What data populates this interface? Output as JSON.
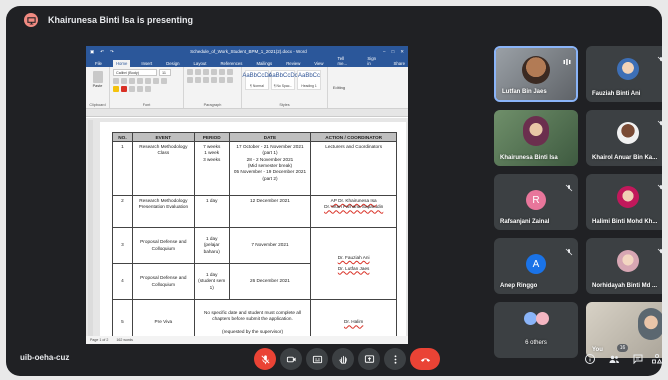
{
  "presenter_bar": {
    "text": "Khairunesa Binti Isa is presenting"
  },
  "word": {
    "title": "Schedule_of_Work_Student_BPM_1_2021(2).docx - Word",
    "tell_me": "Tell me...",
    "sign_in": "Sign in",
    "share": "Share",
    "tabs": [
      "File",
      "Home",
      "Insert",
      "Design",
      "Layout",
      "References",
      "Mailings",
      "Review",
      "View"
    ],
    "font_name": "Calibri (Body)",
    "font_size": "11",
    "paste": "Paste",
    "groups": {
      "clipboard": "Clipboard",
      "font": "Font",
      "paragraph": "Paragraph",
      "styles": "Styles"
    },
    "styles": [
      {
        "preview": "AaBbCcDc",
        "name": "¶ Normal"
      },
      {
        "preview": "AaBbCcDc",
        "name": "¶ No Spac..."
      },
      {
        "preview": "AaBbCc",
        "name": "Heading 1"
      }
    ],
    "editing": "Editing",
    "status": {
      "page": "Page 1 of 2",
      "words": "162 words"
    }
  },
  "schedule": {
    "headers": [
      "NO.",
      "EVENT",
      "PERIOD",
      "DATE",
      "ACTION / COORDINATOR"
    ],
    "rows": [
      {
        "no": "1",
        "event": "Research Methodology Class",
        "period": "7 weeks\n1 week\n3 weeks",
        "date": "17 October - 21 November 2021\n(part 1)\n28 - 2 November 2021\n(Mid semester break)\n05 November - 19 December 2021\n(part 2)",
        "action": "Lecturers and Coordinators"
      },
      {
        "no": "2",
        "event": "Research Methodology Presentation Evaluation",
        "period": "1 day",
        "date": "12 December 2021",
        "action": "AP Dr. Khairunesa Isa\nDr. Intan Farhana Saparudin"
      },
      {
        "no": "3",
        "event": "Proposal Defense and Colloquium",
        "period": "1 day\n(pelajar baharu)",
        "date": "7 November 2021",
        "action": ""
      },
      {
        "no": "4",
        "event": "Proposal Defense and Colloquium",
        "period": "1 day\n(student sem 1)",
        "date": "26 December 2021",
        "action": ""
      },
      {
        "no": "5",
        "event": "Pre Viva",
        "span_text": "No specific date and student must complete all chapters before submit the application.\n\n(requested by the supervisor)",
        "action": "Dr. Halim"
      }
    ],
    "merged_action_34": "Dr. Fauziah Ani\nDr. Lutfan Jaes"
  },
  "participants": [
    {
      "name": "Lutfan Bin Jaes",
      "type": "photo"
    },
    {
      "name": "Fauziah Binti Ani",
      "type": "photo"
    },
    {
      "name": "Khairunesa Binti Isa",
      "type": "photo"
    },
    {
      "name": "Khairol Anuar Bin Ka...",
      "type": "photo"
    },
    {
      "name": "Rafsanjani Zainal",
      "type": "initial",
      "initial": "R",
      "color": "#e8769b"
    },
    {
      "name": "Halimi Binti Mohd Kh...",
      "type": "photo"
    },
    {
      "name": "Anep Ringgo",
      "type": "initial",
      "initial": "A",
      "color": "#1a73e8"
    },
    {
      "name": "Norhidayah Binti Md ...",
      "type": "photo"
    },
    {
      "name": "6 others",
      "type": "group"
    },
    {
      "name": "You",
      "type": "photo"
    }
  ],
  "bottom": {
    "meeting_code": "uib-oeha-cuz",
    "participant_count": "16"
  }
}
